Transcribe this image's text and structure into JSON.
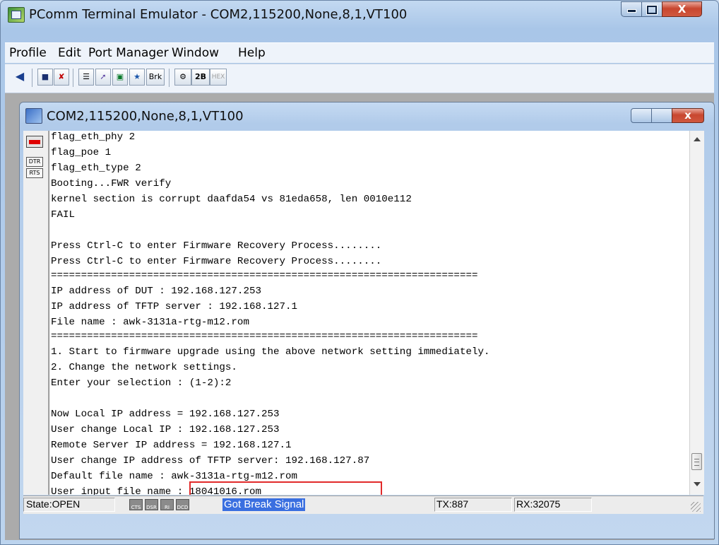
{
  "window": {
    "title": "PComm Terminal Emulator - COM2,115200,None,8,1,VT100",
    "close_glyph": "X"
  },
  "menu": [
    "Profile",
    "Edit",
    "Port Manager",
    "Window",
    "Help"
  ],
  "toolbar": {
    "buttons": [
      "open-icon",
      "save-icon",
      "exit-icon",
      "properties-icon",
      "transfer-icon",
      "capture-icon",
      "pattern-icon",
      "Brk",
      "script-icon",
      "2B",
      "HEX"
    ],
    "brk_label": "Brk",
    "twob_label": "2B",
    "hex_label": "HEX"
  },
  "child": {
    "title": "COM2,115200,None,8,1,VT100",
    "close_glyph": "x"
  },
  "signals": {
    "dtr": "DTR",
    "rts": "RTS"
  },
  "terminal": {
    "lines": [
      "flag_eth_phy 2",
      "flag_poe 1",
      "flag_eth_type 2",
      "Booting...FWR verify",
      "kernel section is corrupt daafda54 vs 81eda658, len 0010e112",
      "FAIL",
      "",
      "Press Ctrl-C to enter Firmware Recovery Process........",
      "Press Ctrl-C to enter Firmware Recovery Process........",
      "=======================================================================",
      "IP address of DUT : 192.168.127.253",
      "IP address of TFTP server : 192.168.127.1",
      "File name : awk-3131a-rtg-m12.rom",
      "=======================================================================",
      "1. Start to firmware upgrade using the above network setting immediately.",
      "2. Change the network settings.",
      "Enter your selection : (1-2):2",
      "",
      "Now Local IP address = 192.168.127.253",
      "User change Local IP : 192.168.127.253",
      "Remote Server IP address = 192.168.127.1",
      "User change IP address of TFTP server: 192.168.127.87",
      "Default file name : awk-3131a-rtg-m12.rom",
      "User input file name : 18041016.rom"
    ]
  },
  "status": {
    "state": "State:OPEN",
    "indicators": [
      "CTS",
      "DSR",
      "RI",
      "DCD"
    ],
    "message": "Got Break Signal",
    "tx": "TX:887",
    "rx": "RX:32075"
  },
  "colors": {
    "highlight_box": "#e22a2a",
    "status_message_bg": "#3a6fe0",
    "rx_led": "#e00000"
  }
}
